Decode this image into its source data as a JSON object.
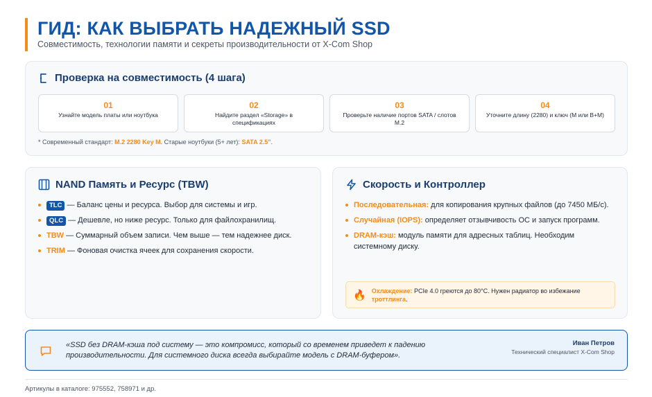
{
  "header": {
    "title": "ГИД: КАК ВЫБРАТЬ НАДЕЖНЫЙ SSD",
    "subtitle": "Совместимость, технологии памяти и секреты производительности от X-Com Shop"
  },
  "compat": {
    "title": "Проверка на совместимость (4 шага)",
    "steps": [
      {
        "num": "01",
        "text": "Узнайте модель платы или ноутбука"
      },
      {
        "num": "02",
        "text": "Найдите раздел «Storage» в спецификациях"
      },
      {
        "num": "03",
        "text": "Проверьте наличие портов SATA / слотов M.2"
      },
      {
        "num": "04",
        "text": "Уточните длину (2280) и ключ (M или B+M)"
      }
    ],
    "note": {
      "prefix": "* Современный стандарт: ",
      "standard": "M.2 2280 Key M",
      "middle": ". Старые ноутбуки (5+ лет): ",
      "legacy": "SATA 2.5\"",
      "suffix": "."
    }
  },
  "nand": {
    "title": "NAND Память и Ресурс (TBW)",
    "items": [
      {
        "tag": "TLC",
        "text": " — Баланс цены и ресурса. Выбор для системы и игр."
      },
      {
        "tag": "QLC",
        "text": " — Дешевле, но ниже ресурс. Только для файлохранилищ."
      },
      {
        "key": "TBW",
        "text": " — Суммарный объем записи. Чем выше — тем надежнее диск."
      },
      {
        "key": "TRIM",
        "text": " — Фоновая очистка ячеек для сохранения скорости."
      }
    ]
  },
  "speed": {
    "title": "Скорость и Контроллер",
    "items": [
      {
        "key": "Последовательная:",
        "text": " для копирования крупных файлов (до 7450 МБ/с)."
      },
      {
        "key": "Случайная (IOPS):",
        "text": " определяет отзывчивость ОС и запуск программ."
      },
      {
        "key": "DRAM-кэш:",
        "text": " модуль памяти для адресных таблиц. Необходим системному диску."
      }
    ],
    "warning": {
      "key": "Охлаждение:",
      "text": " PCIe 4.0 греются до 80°C. Нужен радиатор во избежание ",
      "key2": "троттлинга",
      "end": "."
    }
  },
  "quote": {
    "text": "«SSD без DRAM-кэша под систему — это компромисс, который со временем приведет к падению производительности. Для системного диска всегда выбирайте модель с DRAM-буфером».",
    "author": "Иван Петров",
    "role": "Технический специалист X-Com Shop"
  },
  "footer": {
    "text": "Артикулы в каталоге: 975552, 758971 и др."
  },
  "colors": {
    "accent": "#f28c1a",
    "brand": "#1356a8",
    "title": "#1a3d6e"
  }
}
